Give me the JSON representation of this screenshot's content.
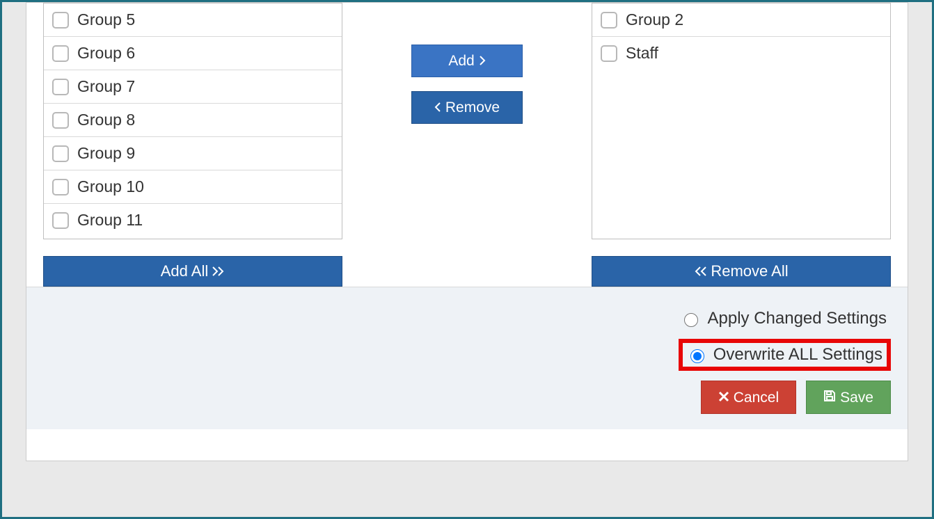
{
  "transfer": {
    "available": [
      "Group 5",
      "Group 6",
      "Group 7",
      "Group 8",
      "Group 9",
      "Group 10",
      "Group 11"
    ],
    "selected": [
      "Group 2",
      "Staff"
    ],
    "add_label": "Add",
    "remove_label": "Remove",
    "add_all_label": "Add All",
    "remove_all_label": "Remove All"
  },
  "settings": {
    "apply_label": "Apply Changed Settings",
    "overwrite_label": "Overwrite ALL Settings",
    "selected": "overwrite"
  },
  "actions": {
    "cancel_label": "Cancel",
    "save_label": "Save"
  }
}
